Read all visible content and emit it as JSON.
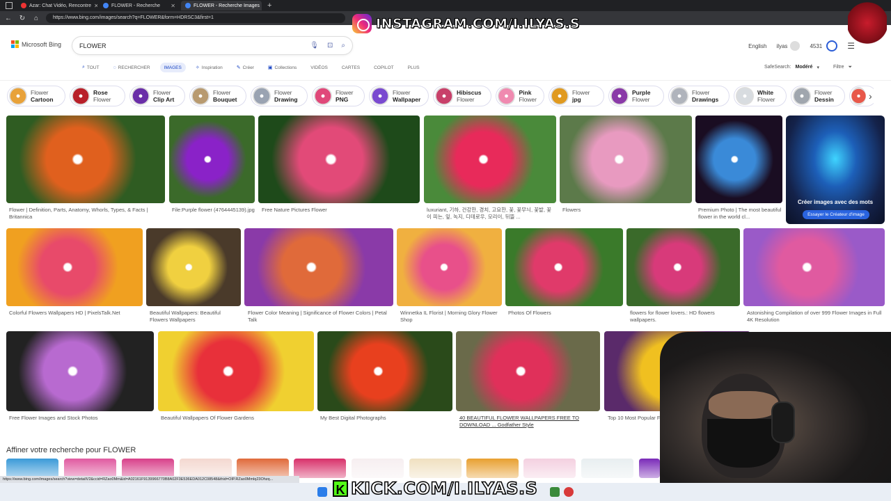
{
  "browser": {
    "tabs": [
      {
        "title": "Azar: Chat Vidéo, Rencontre"
      },
      {
        "title": "FLOWER - Recherche"
      },
      {
        "title": "FLOWER - Recherche Images"
      }
    ],
    "url": "https://www.bing.com/images/search?q=FLOWER&form=HDRSC3&first=1"
  },
  "overlays": {
    "instagram": "INSTAGRAM.COM/I.ILYAS.S",
    "kick": "KICK.COM/I.ILYAS.S"
  },
  "bing": {
    "logo": "Microsoft Bing",
    "query": "FLOWER",
    "language": "English",
    "user": "ilyas",
    "points": "4531",
    "scopes": [
      {
        "label": "TOUT",
        "icon": "search-icon"
      },
      {
        "label": "RECHERCHER",
        "icon": "chat-icon"
      },
      {
        "label": "IMAGES",
        "active": true
      },
      {
        "label": "Inspiration",
        "icon": "inspiration-icon"
      },
      {
        "label": "Créer",
        "icon": "create-icon"
      },
      {
        "label": "Collections",
        "icon": "collections-icon"
      },
      {
        "label": "VIDÉOS"
      },
      {
        "label": "CARTES"
      },
      {
        "label": "COPILOT"
      },
      {
        "label": "PLUS"
      }
    ],
    "safesearch_label": "SafeSearch:",
    "safesearch_value": "Modéré",
    "filter_label": "Filtre"
  },
  "related_chips": [
    {
      "line1": "Flower",
      "line2": "Cartoon",
      "bold": 2,
      "color": "#e8a23a"
    },
    {
      "line1": "Rose",
      "line2": "Flower",
      "bold": 1,
      "color": "#b8202a"
    },
    {
      "line1": "Flower",
      "line2": "Clip Art",
      "bold": 2,
      "color": "#6a2ea8"
    },
    {
      "line1": "Flower",
      "line2": "Bouquet",
      "bold": 2,
      "color": "#b89a70"
    },
    {
      "line1": "Flower",
      "line2": "Drawing",
      "bold": 2,
      "color": "#9aa3b2"
    },
    {
      "line1": "Flower",
      "line2": "PNG",
      "bold": 2,
      "color": "#e0487a"
    },
    {
      "line1": "Flower",
      "line2": "Wallpaper",
      "bold": 2,
      "color": "#7a4ad0"
    },
    {
      "line1": "Hibiscus",
      "line2": "Flower",
      "bold": 1,
      "color": "#c8406a"
    },
    {
      "line1": "Pink",
      "line2": "Flower",
      "bold": 1,
      "color": "#f08ab0"
    },
    {
      "line1": "Flower",
      "line2": "jpg",
      "bold": 2,
      "color": "#e09a20"
    },
    {
      "line1": "Purple",
      "line2": "Flower",
      "bold": 1,
      "color": "#8a3aa8"
    },
    {
      "line1": "Flower",
      "line2": "Drawings",
      "bold": 2,
      "color": "#b0b4bc"
    },
    {
      "line1": "White",
      "line2": "Flower",
      "bold": 1,
      "color": "#d8dce0"
    },
    {
      "line1": "Flower",
      "line2": "Dessin",
      "bold": 2,
      "color": "#a0a6ae"
    },
    {
      "line1": "",
      "line2": "",
      "bold": 0,
      "color": "#e8584a"
    }
  ],
  "results": [
    {
      "caption": "Flower | Definition, Parts, Anatomy, Whorls, Types, & Facts | Britannica",
      "colors": [
        "#e0601e",
        "#2f5c22"
      ]
    },
    {
      "caption": "File:Purple flower (4764445139).jpg",
      "colors": [
        "#8a22c8",
        "#3b6a2a"
      ]
    },
    {
      "caption": "Free Nature Pictures Flower",
      "colors": [
        "#e24a78",
        "#1e4a1a"
      ]
    },
    {
      "caption": "luxuriant, 기하, 건강한, 경치, 고요한, 꽃, 꽃무늬, 꽃밭, 꽃이 피는, 잎, 녹지, 디테로우, 모리이, 뒤뜰 ...",
      "colors": [
        "#e82a5a",
        "#4a8a3a"
      ]
    },
    {
      "caption": "Flowers",
      "colors": [
        "#e89ac0",
        "#5c7a4a"
      ]
    },
    {
      "caption": "Premium Photo | The most beautiful flower in the world cl...",
      "colors": [
        "#3a8ad8",
        "#1a0d22"
      ]
    },
    {
      "caption": "Colorful Flowers Wallpapers HD | PixelsTalk.Net",
      "colors": [
        "#e84a6a",
        "#f0a020"
      ]
    },
    {
      "caption": "Beautiful Wallpapers: Beautiful Flowers Wallpapers",
      "colors": [
        "#f0d040",
        "#4a3a2a"
      ]
    },
    {
      "caption": "Flower Color Meaning | Significance of Flower Colors | Petal Talk",
      "colors": [
        "#e06a3a",
        "#8a3aa8"
      ]
    },
    {
      "caption": "Winnetka IL Florist | Morning Glory Flower Shop",
      "colors": [
        "#e8508a",
        "#f0b040"
      ]
    },
    {
      "caption": "Photos Of Flowers",
      "colors": [
        "#e03a6a",
        "#3a7a2a"
      ]
    },
    {
      "caption": "flowers for flower lovers.: HD flowers wallpapers.",
      "colors": [
        "#d83a7a",
        "#3a6a2a"
      ]
    },
    {
      "caption": "Astonishing Compilation of over 999 Flower Images in Full 4K Resolution",
      "colors": [
        "#e05aa0",
        "#9a5ac8"
      ]
    },
    {
      "caption": "Free Flower Images and Stock Photos",
      "colors": [
        "#b86ad0",
        "#222"
      ]
    },
    {
      "caption": "Beautiful Wallpapers Of Flower Gardens",
      "colors": [
        "#e8303a",
        "#f0d030"
      ]
    },
    {
      "caption": "My Best Digital Photographs",
      "colors": [
        "#e8401e",
        "#2a4a1a"
      ]
    },
    {
      "caption": "40 BEAUTIFUL FLOWER WALLPAPERS FREE TO DOWNLOAD ... Godfather Style",
      "colors": [
        "#e0305a",
        "#6a6a4a"
      ]
    },
    {
      "caption": "Top 10 Most Popular Flowers to Pl...",
      "colors": [
        "#f0c020",
        "#5a2a6a"
      ]
    }
  ],
  "promo": {
    "title": "Créer images avec des mots",
    "button": "Essayer le Créateur d'image"
  },
  "refine_title": "Affiner votre recherche pour FLOWER",
  "status_url": "https://www.bing.com/images/search?view=detailV2&ccid=RZao0Mm&id=A02161F9139966770B8A02F3E536EDA012C08548&thid=OIP.RZao0Mmlq23Ohzq..."
}
